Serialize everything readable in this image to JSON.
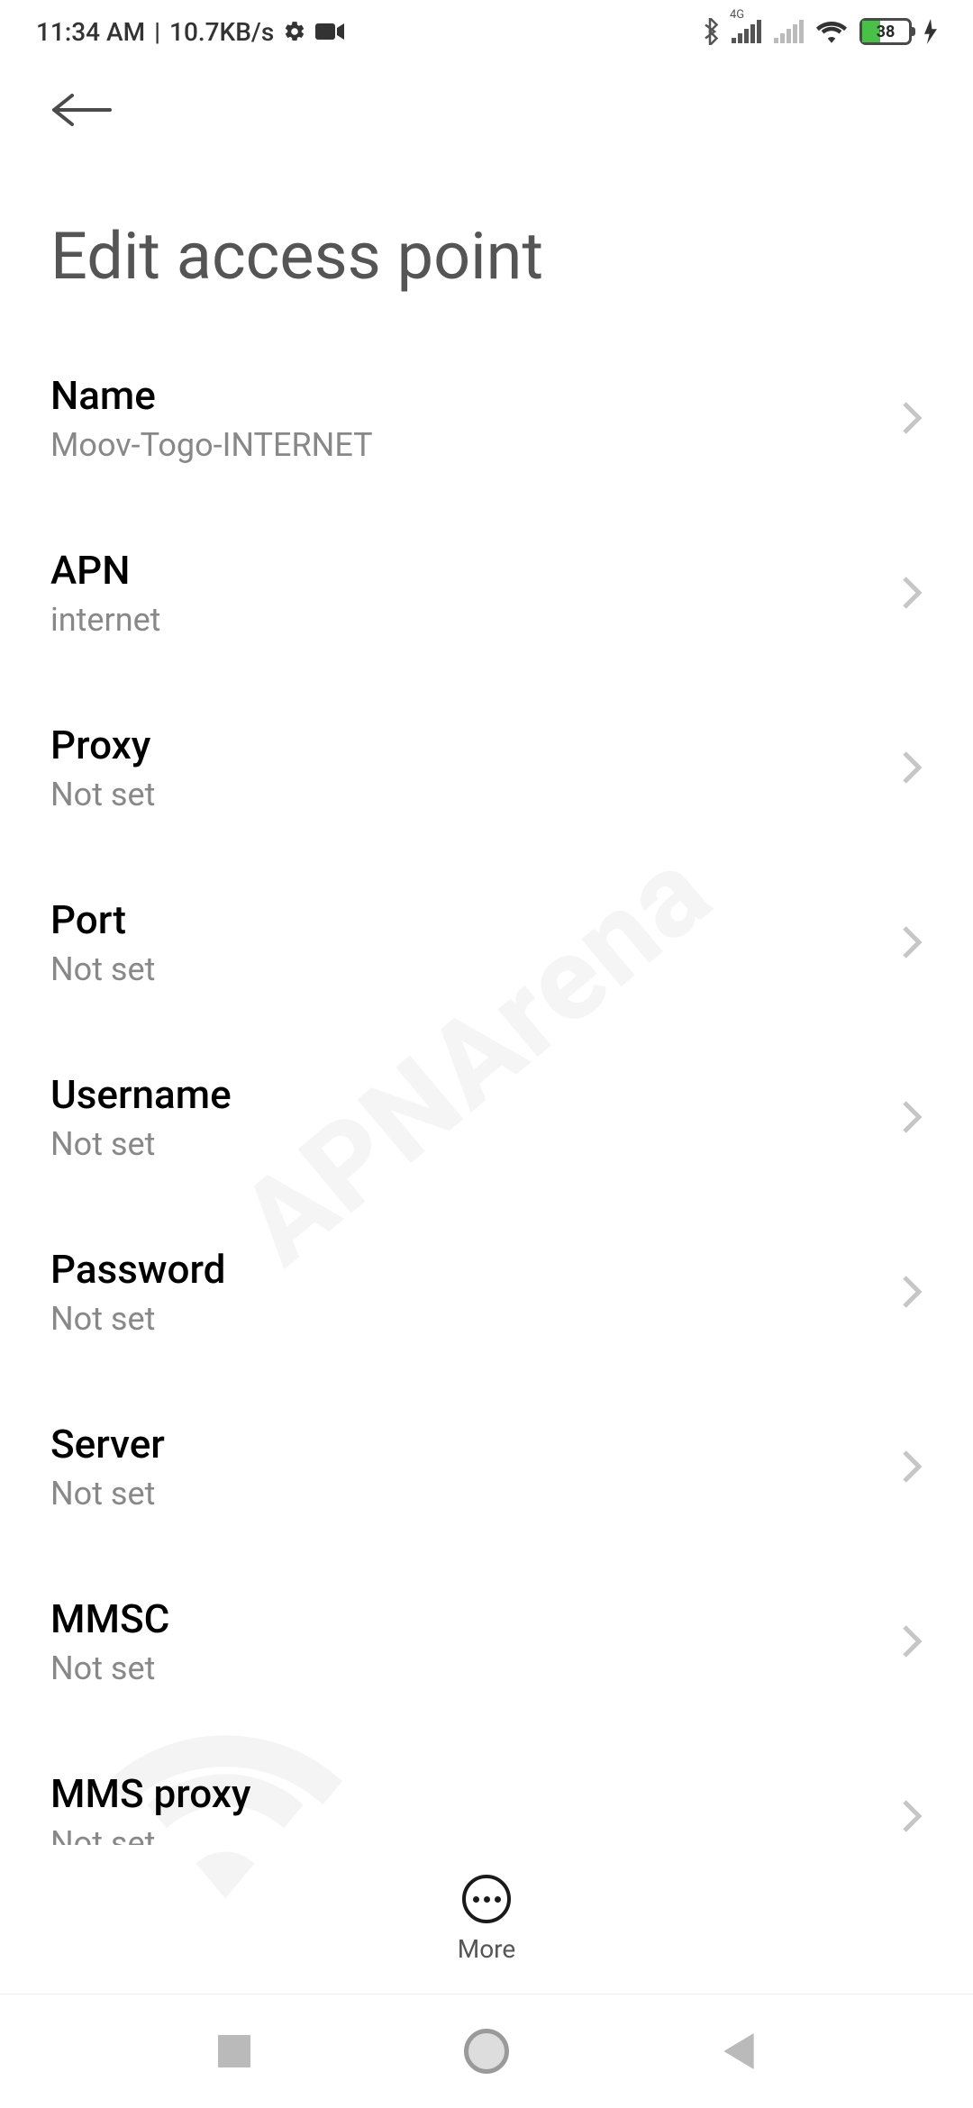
{
  "status_bar": {
    "time": "11:34 AM",
    "data_rate": "10.7KB/s",
    "battery_percent": "38",
    "network_label_1": "4G"
  },
  "header": {
    "title": "Edit access point"
  },
  "fields": [
    {
      "label": "Name",
      "value": "Moov-Togo-INTERNET"
    },
    {
      "label": "APN",
      "value": "internet"
    },
    {
      "label": "Proxy",
      "value": "Not set"
    },
    {
      "label": "Port",
      "value": "Not set"
    },
    {
      "label": "Username",
      "value": "Not set"
    },
    {
      "label": "Password",
      "value": "Not set"
    },
    {
      "label": "Server",
      "value": "Not set"
    },
    {
      "label": "MMSC",
      "value": "Not set"
    },
    {
      "label": "MMS proxy",
      "value": "Not set"
    }
  ],
  "toolbar": {
    "more_label": "More"
  },
  "watermark": {
    "text": "APNArena"
  }
}
